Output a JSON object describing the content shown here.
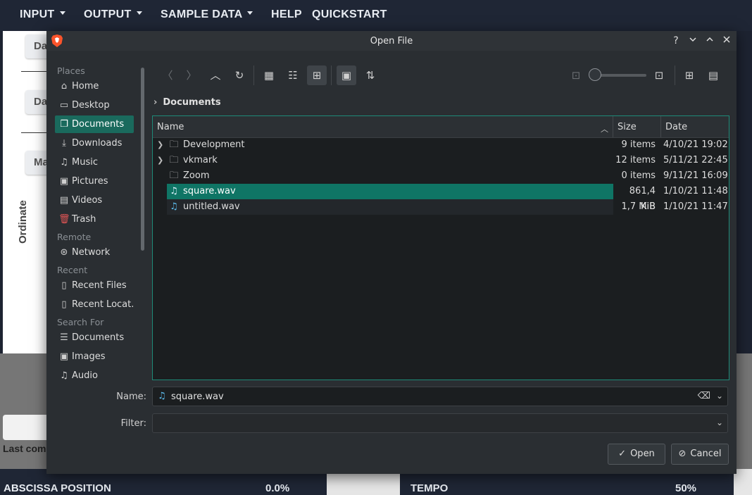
{
  "app": {
    "menu": [
      {
        "label": "INPUT",
        "caret": true
      },
      {
        "label": "OUTPUT",
        "caret": true
      },
      {
        "label": "SAMPLE DATA",
        "caret": true
      },
      {
        "label": "HELP",
        "caret": false
      },
      {
        "label": "QUICKSTART",
        "caret": false
      }
    ],
    "side_buttons": [
      "Da",
      "Da",
      "Ma"
    ],
    "ordinate_label": "Ordinate",
    "last_command_label": "Last com",
    "bottom": {
      "abscissa_label": "ABSCISSA POSITION",
      "abscissa_value": "0.0%",
      "tempo_label": "TEMPO",
      "tempo_value": "50%"
    }
  },
  "dialog": {
    "title": "Open File",
    "titlebar_buttons": {
      "help": "?",
      "minimize": "⌄",
      "maximize": "⌃",
      "close": "✕"
    },
    "places": {
      "sections": {
        "places": "Places",
        "remote": "Remote",
        "recent": "Recent",
        "search_for": "Search For"
      },
      "places_items": [
        {
          "label": "Home",
          "icon": "home-icon"
        },
        {
          "label": "Desktop",
          "icon": "desktop-icon"
        },
        {
          "label": "Documents",
          "icon": "documents-icon",
          "active": true
        },
        {
          "label": "Downloads",
          "icon": "downloads-icon"
        },
        {
          "label": "Music",
          "icon": "music-icon"
        },
        {
          "label": "Pictures",
          "icon": "pictures-icon"
        },
        {
          "label": "Videos",
          "icon": "videos-icon"
        },
        {
          "label": "Trash",
          "icon": "trash-icon"
        }
      ],
      "remote_items": [
        {
          "label": "Network",
          "icon": "network-icon"
        }
      ],
      "recent_items": [
        {
          "label": "Recent Files",
          "icon": "recent-files-icon"
        },
        {
          "label": "Recent Locat...",
          "icon": "recent-locations-icon"
        }
      ],
      "search_items": [
        {
          "label": "Documents",
          "icon": "search-documents-icon"
        },
        {
          "label": "Images",
          "icon": "search-images-icon"
        },
        {
          "label": "Audio",
          "icon": "search-audio-icon"
        }
      ]
    },
    "breadcrumb": "Documents",
    "columns": {
      "name": "Name",
      "size": "Size",
      "date": "Date"
    },
    "files": [
      {
        "name": "Development",
        "size": "9 items",
        "date": "4/10/21 19:02",
        "type": "folder",
        "expandable": true
      },
      {
        "name": "vkmark",
        "size": "12 items",
        "date": "5/11/21 22:45",
        "type": "folder",
        "expandable": true
      },
      {
        "name": "Zoom",
        "size": "0 items",
        "date": "9/11/21 16:09",
        "type": "folder",
        "expandable": false
      },
      {
        "name": "square.wav",
        "size": "861,4 KiB",
        "date": "1/10/21 11:48",
        "type": "audio",
        "selected": true
      },
      {
        "name": "untitled.wav",
        "size": "1,7 MiB",
        "date": "1/10/21 11:47",
        "type": "audio"
      }
    ],
    "name_label": "Name:",
    "name_value": "square.wav",
    "filter_label": "Filter:",
    "filter_value": "",
    "open_label": "Open",
    "cancel_label": "Cancel",
    "colors": {
      "accent": "#1a6a5d",
      "selection": "#0f7565",
      "border_focus": "#1e8a78",
      "audio_icon": "#5dbef0"
    }
  }
}
